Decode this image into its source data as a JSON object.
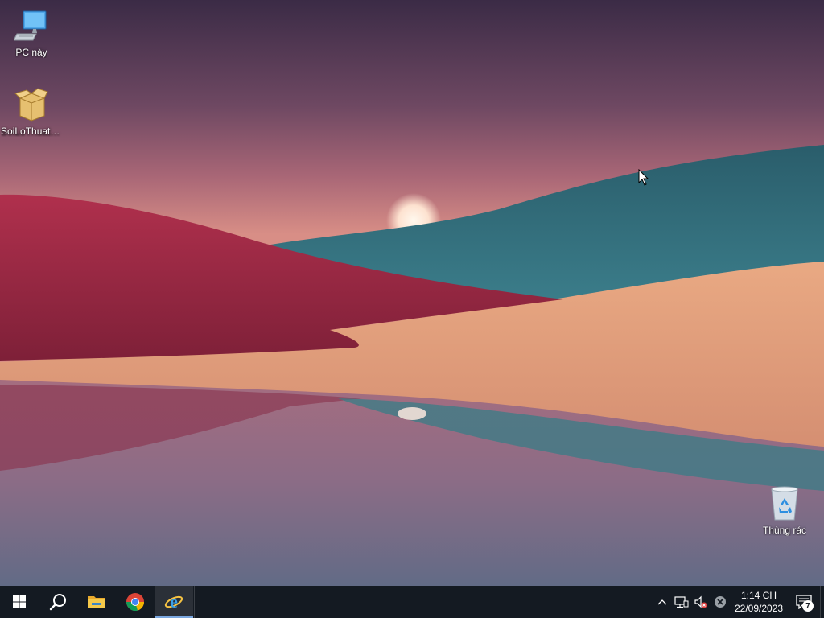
{
  "desktop": {
    "icons": [
      {
        "label": "PC này",
        "icon": "computer-icon"
      },
      {
        "label": "SoiLoThuat_...",
        "icon": "package-icon"
      },
      {
        "label": "Thùng rác",
        "icon": "recycle-bin-icon"
      }
    ],
    "wallpaper": {
      "sky_top": "#3a2a45",
      "hill_red": "#9c2b47",
      "hill_teal": "#2f6a78",
      "field_orange": "#e3a27e"
    }
  },
  "taskbar": {
    "background": "#141a22",
    "buttons": [
      {
        "name": "start",
        "icon": "windows-logo-icon"
      },
      {
        "name": "search",
        "icon": "search-icon"
      },
      {
        "name": "file-explorer",
        "icon": "folder-icon"
      },
      {
        "name": "chrome",
        "icon": "chrome-icon"
      },
      {
        "name": "internet-explorer",
        "icon": "internet-explorer-icon",
        "active": true
      }
    ],
    "tray": {
      "icons": [
        "chevron-up-icon",
        "network-icon",
        "volume-muted-icon",
        "error-icon"
      ],
      "time": "1:14 CH",
      "date": "22/09/2023",
      "notification_count": "7"
    }
  }
}
